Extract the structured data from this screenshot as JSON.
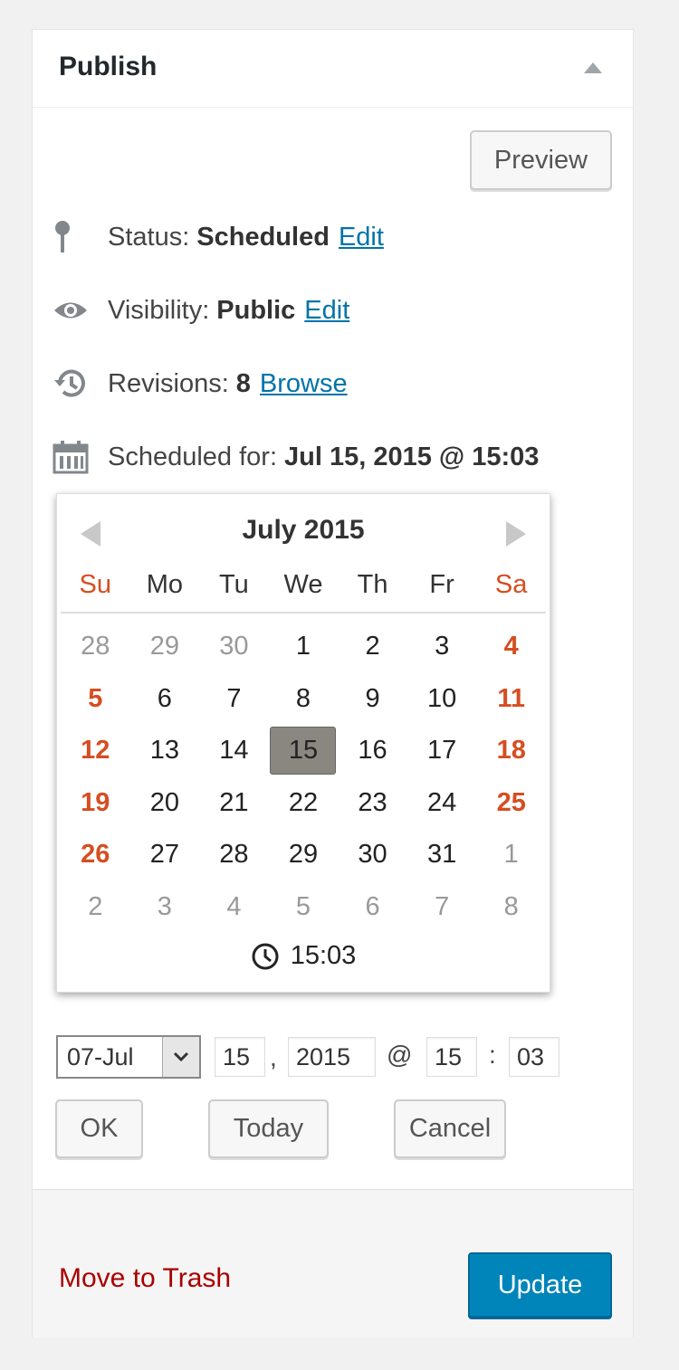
{
  "panel": {
    "title": "Publish",
    "preview_label": "Preview"
  },
  "status": {
    "label": "Status:",
    "value": "Scheduled",
    "link": "Edit"
  },
  "visibility": {
    "label": "Visibility:",
    "value": "Public",
    "link": "Edit"
  },
  "revisions": {
    "label": "Revisions:",
    "value": "8",
    "link": "Browse"
  },
  "schedule": {
    "label": "Scheduled for:",
    "value": "Jul 15, 2015 @ 15:03"
  },
  "calendar": {
    "title": "July 2015",
    "weekdays": [
      "Su",
      "Mo",
      "Tu",
      "We",
      "Th",
      "Fr",
      "Sa"
    ],
    "days": [
      [
        "28",
        "29",
        "30",
        "1",
        "2",
        "3",
        "4"
      ],
      [
        "5",
        "6",
        "7",
        "8",
        "9",
        "10",
        "11"
      ],
      [
        "12",
        "13",
        "14",
        "15",
        "16",
        "17",
        "18"
      ],
      [
        "19",
        "20",
        "21",
        "22",
        "23",
        "24",
        "25"
      ],
      [
        "26",
        "27",
        "28",
        "29",
        "30",
        "31",
        "1"
      ],
      [
        "2",
        "3",
        "4",
        "5",
        "6",
        "7",
        "8"
      ]
    ],
    "selected_day": "15",
    "time": "15:03"
  },
  "fields": {
    "month": "07-Jul",
    "day": "15",
    "comma": ",",
    "year": "2015",
    "at": "@",
    "hour": "15",
    "colon": ":",
    "minute": "03"
  },
  "buttons": {
    "ok": "OK",
    "today": "Today",
    "cancel": "Cancel"
  },
  "footer": {
    "trash_label": "Move to Trash",
    "update_label": "Update"
  },
  "colors": {
    "accent": "#0073aa",
    "weekend": "#d54e21",
    "trash": "#a00000",
    "update_bg": "#0085ba"
  }
}
